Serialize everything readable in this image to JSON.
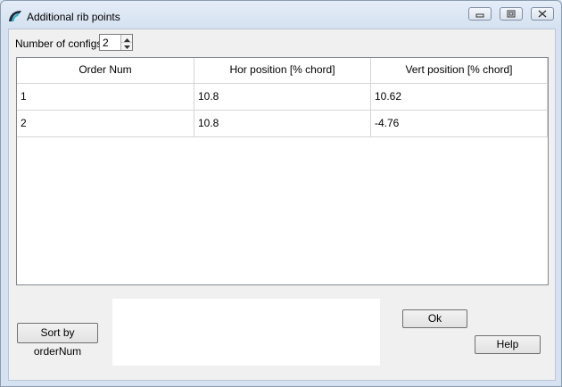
{
  "window": {
    "title": "Additional rib points",
    "controls": [
      "minimize-icon",
      "maximize-icon",
      "close-icon"
    ]
  },
  "configs": {
    "label": "Number of configs",
    "value": "2"
  },
  "table": {
    "columns": [
      "Order Num",
      "Hor position [% chord]",
      "Vert position [% chord]"
    ],
    "rows": [
      [
        "1",
        "10.8",
        "10.62"
      ],
      [
        "2",
        "10.8",
        "-4.76"
      ]
    ]
  },
  "buttons": {
    "sort": "Sort by orderNum",
    "ok": "Ok",
    "help": "Help"
  },
  "colors": {
    "titlebar": "#dbe6f4",
    "client": "#f0f0f0",
    "grid_lines": "#d5d5d5"
  }
}
